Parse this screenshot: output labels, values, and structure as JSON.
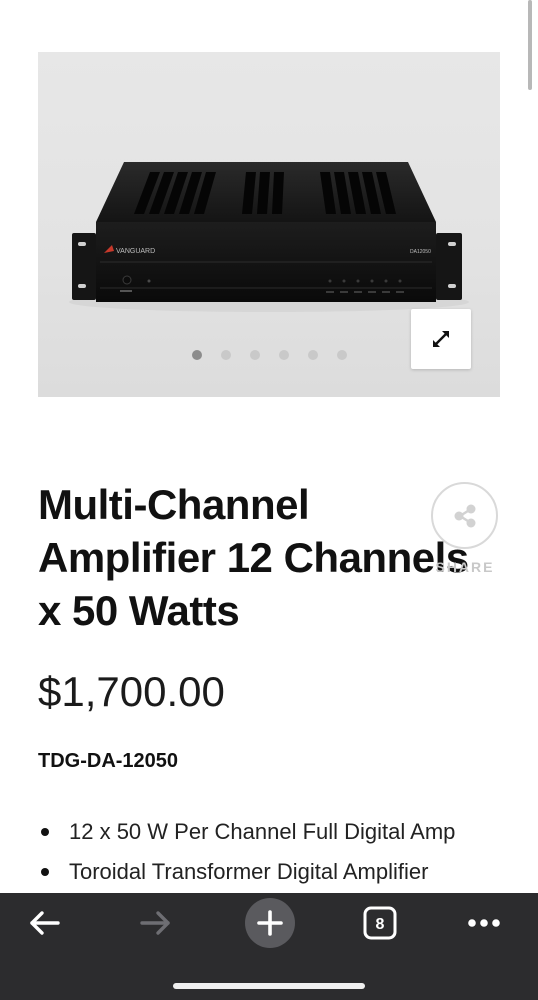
{
  "product": {
    "brand_on_device": "VANGUARD",
    "model_on_device": "DA12050",
    "title": "Multi-Channel Amplifier 12 Channels x 50 Watts",
    "price": "$1,700.00",
    "sku": "TDG-DA-12050",
    "features": [
      "12 x 50 W Per Channel Full Digital Amp",
      "Toroidal Transformer Digital Amplifier"
    ]
  },
  "gallery": {
    "image_count": 6,
    "active_index": 0
  },
  "share": {
    "label": "SHARE"
  },
  "toolbar": {
    "tab_count": "8"
  },
  "icons": {
    "expand": "expand-arrows-icon",
    "share": "share-icon",
    "back": "back-arrow-icon",
    "forward": "forward-arrow-icon",
    "new_tab": "plus-icon",
    "tabs": "tabs-icon",
    "more": "more-icon"
  },
  "colors": {
    "toolbar_bg": "#2c2c2e",
    "dot_active": "#8c8c8c",
    "dot_inactive": "#c9c9c9"
  }
}
